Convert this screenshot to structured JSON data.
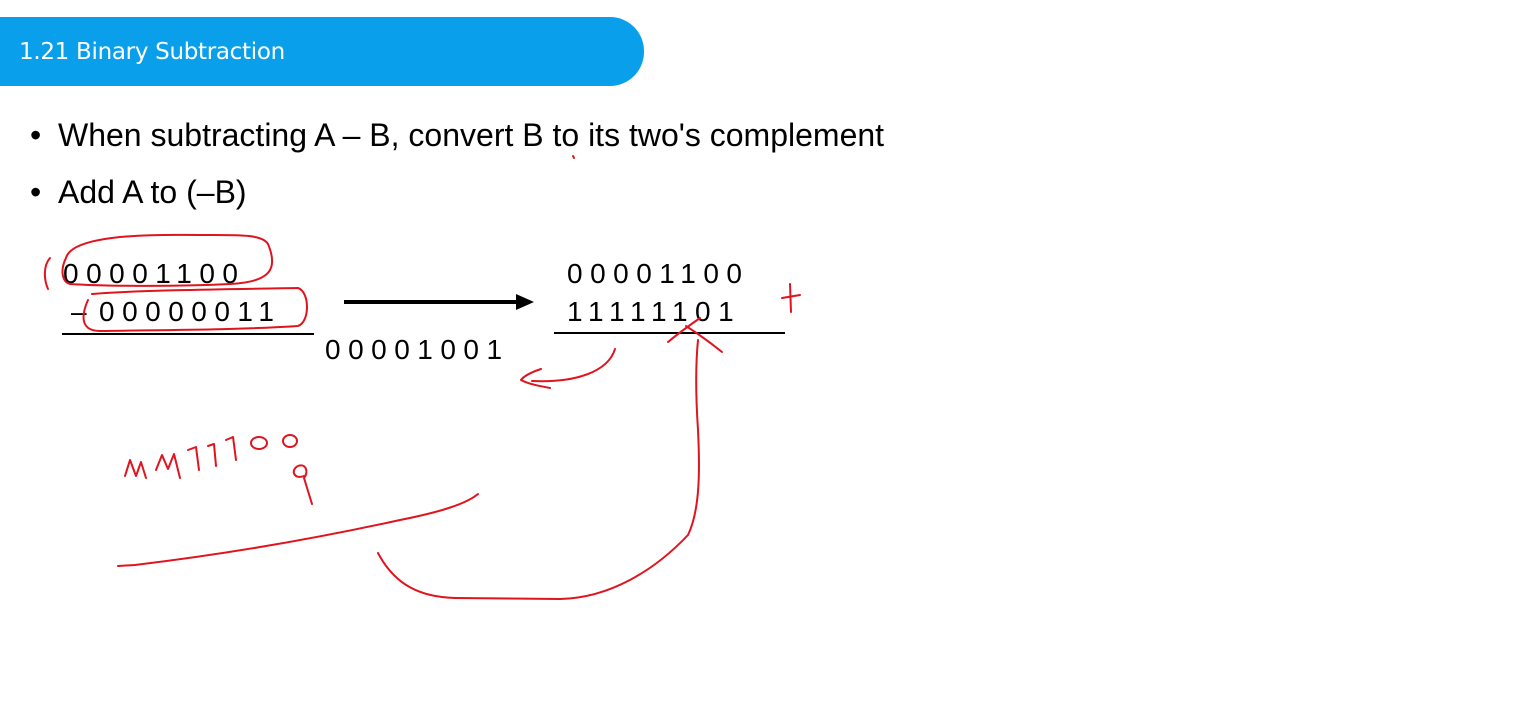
{
  "slide": {
    "title": "1.21 Binary Subtraction",
    "bullets": [
      "When subtracting A – B, convert B to its two's complement",
      "Add A to (–B)"
    ]
  },
  "worked_example": {
    "left": {
      "a": "00001100",
      "operator": "–",
      "b": "00000011",
      "result": "00001001"
    },
    "right": {
      "a": "00001100",
      "b_complement": "11111101"
    }
  },
  "annotations": {
    "ink_color": "#e0141e",
    "handwritten_note": "1111100 / 9"
  }
}
